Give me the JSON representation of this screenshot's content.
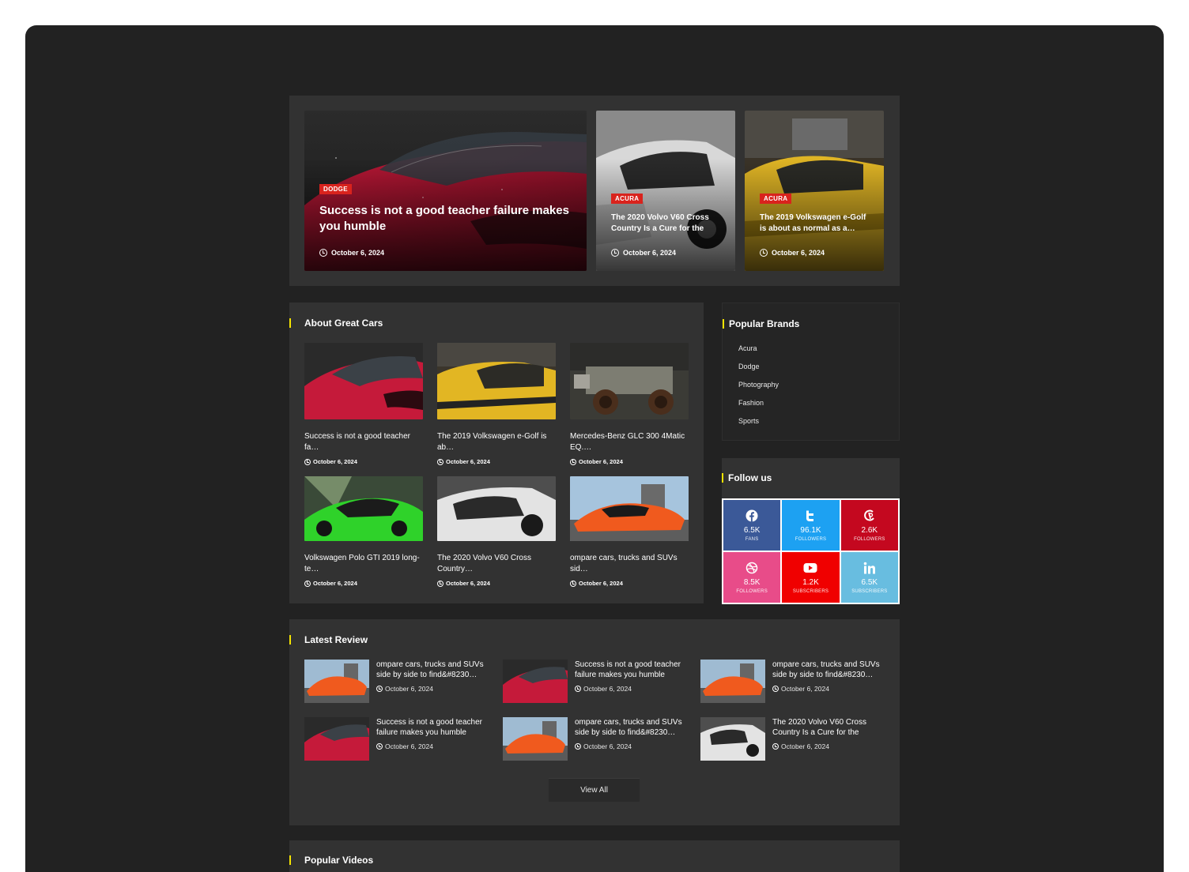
{
  "hero": {
    "main": {
      "badge": "DODGE",
      "title": "Success is not a good teacher failure makes you humble",
      "date": "October 6, 2024"
    },
    "second": {
      "badge": "ACURA",
      "title": "The 2020 Volvo V60 Cross Country Is a Cure for the",
      "date": "October 6, 2024"
    },
    "third": {
      "badge": "ACURA",
      "title": "The 2019 Volkswagen e-Golf is about as normal as a…",
      "date": "October 6, 2024"
    }
  },
  "about": {
    "title": "About Great Cars",
    "items": [
      {
        "title": "Success is not a good teacher fa…",
        "date": "October 6, 2024"
      },
      {
        "title": "The 2019 Volkswagen e-Golf is ab…",
        "date": "October 6, 2024"
      },
      {
        "title": "Mercedes-Benz GLC 300 4Matic EQ.…",
        "date": "October 6, 2024"
      },
      {
        "title": "Volkswagen Polo GTI 2019 long-te…",
        "date": "October 6, 2024"
      },
      {
        "title": "The 2020 Volvo V60 Cross Country…",
        "date": "October 6, 2024"
      },
      {
        "title": "ompare cars, trucks and SUVs sid…",
        "date": "October 6, 2024"
      }
    ]
  },
  "brands": {
    "title": "Popular Brands",
    "items": [
      "Acura",
      "Dodge",
      "Photography",
      "Fashion",
      "Sports"
    ]
  },
  "follow": {
    "title": "Follow us",
    "items": [
      {
        "icon": "facebook-icon",
        "count": "6.5K",
        "label": "FANS",
        "color": "#3b5998"
      },
      {
        "icon": "twitter-icon",
        "count": "96.1K",
        "label": "FOLLOWERS",
        "color": "#1da1f2"
      },
      {
        "icon": "pinterest-icon",
        "count": "2.6K",
        "label": "FOLLOWERS",
        "color": "#c4081f"
      },
      {
        "icon": "dribbble-icon",
        "count": "8.5K",
        "label": "FOLLOWERS",
        "color": "#e84c89"
      },
      {
        "icon": "youtube-icon",
        "count": "1.2K",
        "label": "SUBSCRIBERS",
        "color": "#f00000"
      },
      {
        "icon": "linkedin-icon",
        "count": "6.5K",
        "label": "SUBSCRIBERS",
        "color": "#68bde0"
      }
    ]
  },
  "latest": {
    "title": "Latest Review",
    "items": [
      {
        "title": "ompare cars, trucks and SUVs side by side to find&#8230…",
        "date": "October 6, 2024"
      },
      {
        "title": "Success is not a good teacher failure makes you humble",
        "date": "October 6, 2024"
      },
      {
        "title": "ompare cars, trucks and SUVs side by side to find&#8230…",
        "date": "October 6, 2024"
      },
      {
        "title": "Success is not a good teacher failure makes you humble",
        "date": "October 6, 2024"
      },
      {
        "title": "ompare cars, trucks and SUVs side by side to find&#8230…",
        "date": "October 6, 2024"
      },
      {
        "title": "The 2020 Volvo V60 Cross Country Is a Cure for the",
        "date": "October 6, 2024"
      }
    ],
    "view_all": "View All"
  },
  "videos": {
    "title": "Popular Videos"
  },
  "colors": {
    "accent": "#f5e400",
    "badge": "#d9231d",
    "panel": "#323232",
    "background": "#222222"
  }
}
